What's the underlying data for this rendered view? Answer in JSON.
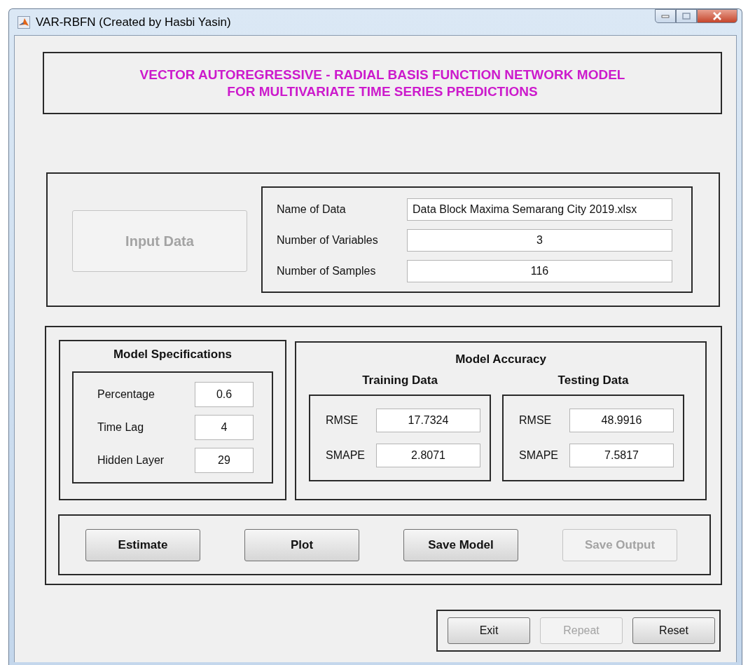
{
  "window": {
    "title": "VAR-RBFN (Created by Hasbi Yasin)"
  },
  "header": {
    "lines": [
      "VECTOR AUTOREGRESSIVE - RADIAL BASIS FUNCTION NETWORK MODEL",
      "FOR MULTIVARIATE TIME SERIES PREDICTIONS"
    ]
  },
  "data_panel": {
    "input_button": {
      "label": "Input Data",
      "disabled": true
    },
    "fields": [
      {
        "label": "Name of Data",
        "value": "Data Block Maxima Semarang City 2019.xlsx"
      },
      {
        "label": "Number of Variables",
        "value": "3"
      },
      {
        "label": "Number of Samples",
        "value": "116"
      }
    ]
  },
  "model_specifications": {
    "title": "Model Specifications",
    "fields": [
      {
        "label": "Percentage",
        "value": "0.6"
      },
      {
        "label": "Time Lag",
        "value": "4"
      },
      {
        "label": "Hidden Layer",
        "value": "29"
      }
    ]
  },
  "model_accuracy": {
    "title": "Model Accuracy",
    "groups": [
      {
        "title": "Training Data",
        "fields": [
          {
            "label": "RMSE",
            "value": "17.7324"
          },
          {
            "label": "SMAPE",
            "value": "2.8071"
          }
        ]
      },
      {
        "title": "Testing Data",
        "fields": [
          {
            "label": "RMSE",
            "value": "48.9916"
          },
          {
            "label": "SMAPE",
            "value": "7.5817"
          }
        ]
      }
    ]
  },
  "action_buttons": [
    {
      "label": "Estimate",
      "disabled": false
    },
    {
      "label": "Plot",
      "disabled": false
    },
    {
      "label": "Save Model",
      "disabled": false
    },
    {
      "label": "Save Output",
      "disabled": true
    }
  ],
  "footer_buttons": [
    {
      "label": "Exit",
      "disabled": false
    },
    {
      "label": "Repeat",
      "disabled": true
    },
    {
      "label": "Reset",
      "disabled": false
    }
  ]
}
